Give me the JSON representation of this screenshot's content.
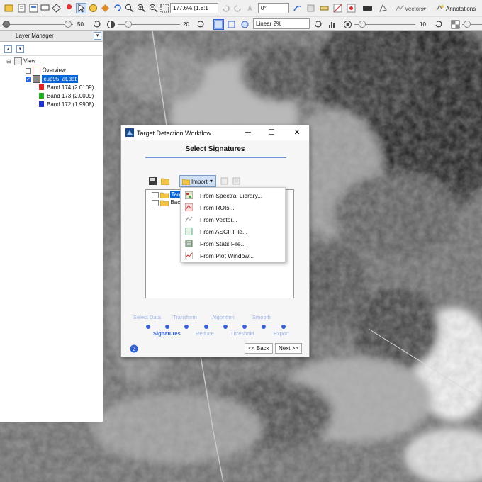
{
  "toolbar": {
    "zoom_value": "177.6% (1.8:1",
    "rotation_value": "0°",
    "vectors_label": "Vectors",
    "annotations_label": "Annotations"
  },
  "toolbar2": {
    "brightness_value": "50",
    "contrast_value": "20",
    "stretch_value": "Linear 2%",
    "sharpen_value": "10"
  },
  "layer_manager": {
    "title": "Layer Manager",
    "view_label": "View",
    "file_label": "cup95_at.dat",
    "bands": [
      {
        "label": "Band 174 (2.0109)",
        "color": "#dd2222"
      },
      {
        "label": "Band 173 (2.0009)",
        "color": "#22aa22"
      },
      {
        "label": "Band 172 (1.9908)",
        "color": "#2233cc"
      }
    ]
  },
  "dialog": {
    "title": "Target Detection Workflow",
    "heading": "Select Signatures",
    "import_label": "Import",
    "tree_item_1": "Targ",
    "tree_item_2": "Bac",
    "menu_items": [
      "From Spectral Library...",
      "From ROIs...",
      "From Vector...",
      "From ASCII File...",
      "From Stats File...",
      "From Plot Window..."
    ],
    "steps_top": [
      "Select Data",
      "Transform",
      "Algorithm",
      "Smooth"
    ],
    "steps_bottom": [
      "Signatures",
      "Reduce",
      "Threshold",
      "Export"
    ],
    "back_label": "<< Back",
    "next_label": "Next >>"
  },
  "colors": {
    "accent": "#2f62d6",
    "step_inactive": "#9db3e6",
    "selection": "#0a64d8"
  }
}
